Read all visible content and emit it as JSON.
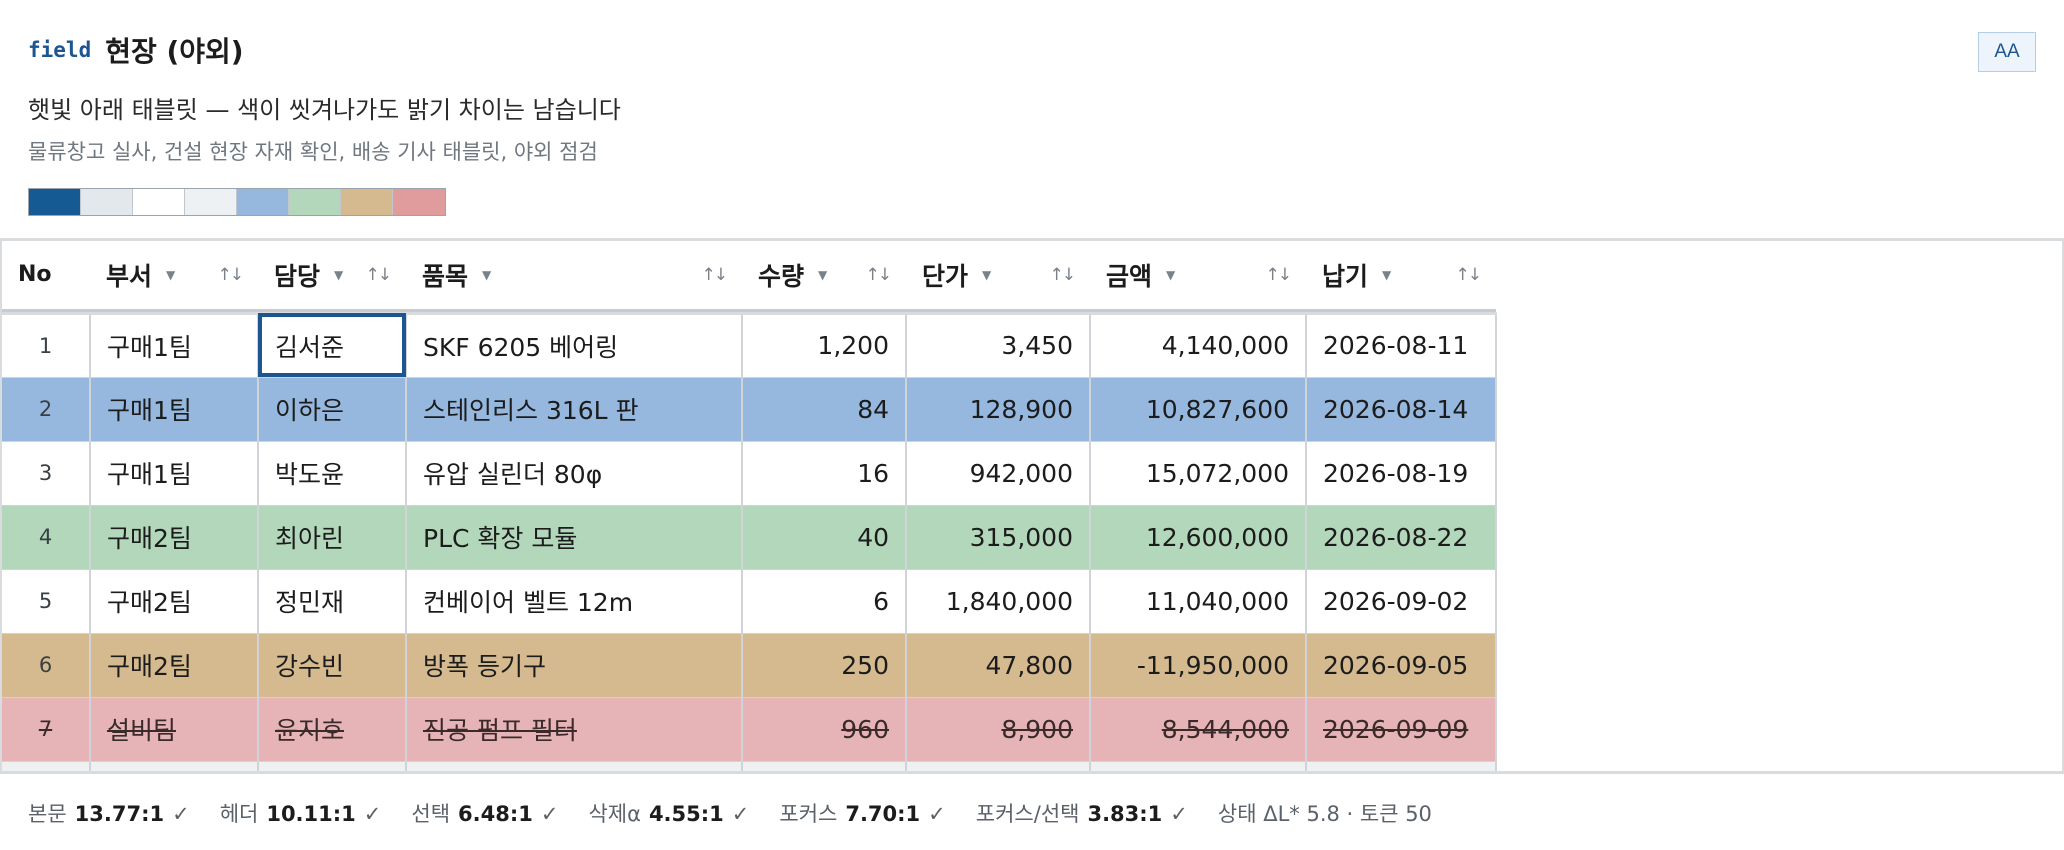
{
  "header": {
    "tag": "field",
    "title": "현장 (야외)",
    "aa_label": "AA",
    "subtitle": "햇빛 아래 태블릿 — 색이 씻겨나가도 밝기 차이는 남습니다",
    "description": "물류창고 실사, 건설 현장 자재 확인, 배송 기사 태블릿, 야외 점검"
  },
  "palette": [
    "#155a93",
    "#e3e8ec",
    "#ffffff",
    "#eef1f4",
    "#96b8de",
    "#b3d7ba",
    "#d5ba8f",
    "#e09b9c"
  ],
  "table": {
    "columns": [
      "No",
      "부서",
      "담당",
      "품목",
      "수량",
      "단가",
      "금액",
      "납기"
    ],
    "rows": [
      {
        "no": "1",
        "dept": "구매1팀",
        "owner": "김서준",
        "item": "SKF 6205 베어링",
        "qty": "1,200",
        "price": "3,450",
        "amount": "4,140,000",
        "due": "2026-08-11"
      },
      {
        "no": "2",
        "dept": "구매1팀",
        "owner": "이하은",
        "item": "스테인리스 316L 판",
        "qty": "84",
        "price": "128,900",
        "amount": "10,827,600",
        "due": "2026-08-14"
      },
      {
        "no": "3",
        "dept": "구매1팀",
        "owner": "박도윤",
        "item": "유압 실린더 80φ",
        "qty": "16",
        "price": "942,000",
        "amount": "15,072,000",
        "due": "2026-08-19"
      },
      {
        "no": "4",
        "dept": "구매2팀",
        "owner": "최아린",
        "item": "PLC 확장 모듈",
        "qty": "40",
        "price": "315,000",
        "amount": "12,600,000",
        "due": "2026-08-22"
      },
      {
        "no": "5",
        "dept": "구매2팀",
        "owner": "정민재",
        "item": "컨베이어 벨트 12m",
        "qty": "6",
        "price": "1,840,000",
        "amount": "11,040,000",
        "due": "2026-09-02"
      },
      {
        "no": "6",
        "dept": "구매2팀",
        "owner": "강수빈",
        "item": "방폭 등기구",
        "qty": "250",
        "price": "47,800",
        "amount": "-11,950,000",
        "due": "2026-09-05"
      },
      {
        "no": "7",
        "dept": "설비팀",
        "owner": "윤지호",
        "item": "진공 펌프 필터",
        "qty": "960",
        "price": "8,900",
        "amount": "8,544,000",
        "due": "2026-09-09"
      }
    ]
  },
  "footer": {
    "body_label": "본문",
    "body_value": "13.77:1",
    "header_label": "헤더",
    "header_value": "10.11:1",
    "selected_label": "선택",
    "selected_value": "6.48:1",
    "deleted_label": "삭제α",
    "deleted_value": "4.55:1",
    "focus_label": "포커스",
    "focus_value": "7.70:1",
    "focus_sel_label": "포커스/선택",
    "focus_sel_value": "3.83:1",
    "check": "✓",
    "status_text": "상태 ΔL* 5.8 · 토큰 50"
  }
}
